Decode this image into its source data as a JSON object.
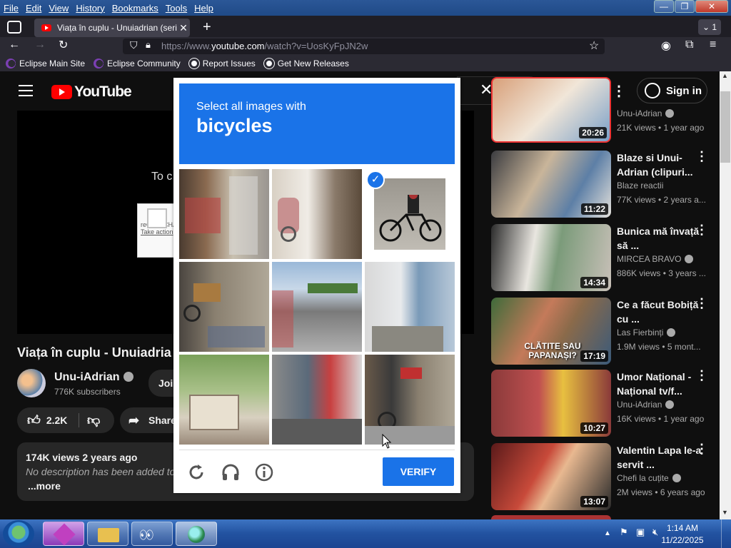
{
  "menubar": {
    "items": [
      "File",
      "Edit",
      "View",
      "History",
      "Bookmarks",
      "Tools",
      "Help"
    ]
  },
  "window_buttons": {
    "minimize": "—",
    "maximize": "❐",
    "close": "✕"
  },
  "tab": {
    "title": "Viața în cuplu - Unuiadrian (seri",
    "close": "✕",
    "new_tab": "+",
    "count": "1"
  },
  "url": {
    "prefix": "https://www.",
    "host": "youtube.com",
    "path": "/watch?v=UosKyFpJN2w"
  },
  "bookmarks": [
    {
      "label": "Eclipse Main Site",
      "icon": "eclipse-icon"
    },
    {
      "label": "Eclipse Community",
      "icon": "eclipse-icon"
    },
    {
      "label": "Report Issues",
      "icon": "github-icon"
    },
    {
      "label": "Get New Releases",
      "icon": "github-icon"
    }
  ],
  "youtube": {
    "logo": "YouTube",
    "sign_in": "Sign in",
    "player_text": "To c",
    "recaptcha": {
      "label": "reCAPTCHA",
      "link": "Take action"
    },
    "video_title": "Viața în cuplu - Unuiadria",
    "channel": {
      "name": "Unu-iAdrian",
      "subscribers": "776K subscribers"
    },
    "join_label": "Joi",
    "likes": "2.2K",
    "share_label": "Share",
    "description": {
      "stats": "174K views  2 years ago",
      "text": "No description has been added to",
      "more": "...more"
    },
    "related": [
      {
        "title": "",
        "channel": "Unu-iAdrian",
        "meta": "21K views • 1 year ago",
        "duration": "20:26",
        "verified": true
      },
      {
        "title": "Blaze si Unui-Adrian (clipuri...",
        "channel": "Blaze reactii",
        "meta": "77K views • 2 years a...",
        "duration": "11:22",
        "verified": false
      },
      {
        "title": "Bunica mă învață să ...",
        "channel": "MIRCEA BRAVO",
        "meta": "886K views • 3 years ...",
        "duration": "14:34",
        "verified": true
      },
      {
        "title": "Ce a făcut Bobiță cu ...",
        "channel": "Las Fierbinți",
        "meta": "1.9M views • 5 mont...",
        "duration": "17:19",
        "verified": true,
        "overlay": "CLĂTITE SAU PAPANAȘI?"
      },
      {
        "title": "Umor Național - Național tv/f...",
        "channel": "Unu-iAdrian",
        "meta": "16K views • 1 year ago",
        "duration": "10:27",
        "verified": true
      },
      {
        "title": "Valentin Lapa le-a servit ...",
        "channel": "Chefi la cuțite",
        "meta": "2M views • 6 years ago",
        "duration": "13:07",
        "verified": true
      }
    ]
  },
  "captcha": {
    "instruction": "Select all images with",
    "target": "bicycles",
    "verify_label": "VERIFY",
    "tiles": [
      {
        "scene": "shop-front",
        "selected": false
      },
      {
        "scene": "scooter-doorway",
        "selected": false
      },
      {
        "scene": "cyclist",
        "selected": true
      },
      {
        "scene": "bicycle-wall",
        "selected": false
      },
      {
        "scene": "city-street",
        "selected": false
      },
      {
        "scene": "houses-alley",
        "selected": false
      },
      {
        "scene": "garden-shed",
        "selected": false
      },
      {
        "scene": "building-street",
        "selected": false
      },
      {
        "scene": "bicycle-shop",
        "selected": false
      }
    ]
  },
  "taskbar": {
    "time": "1:14 AM",
    "date": "11/22/2025"
  }
}
